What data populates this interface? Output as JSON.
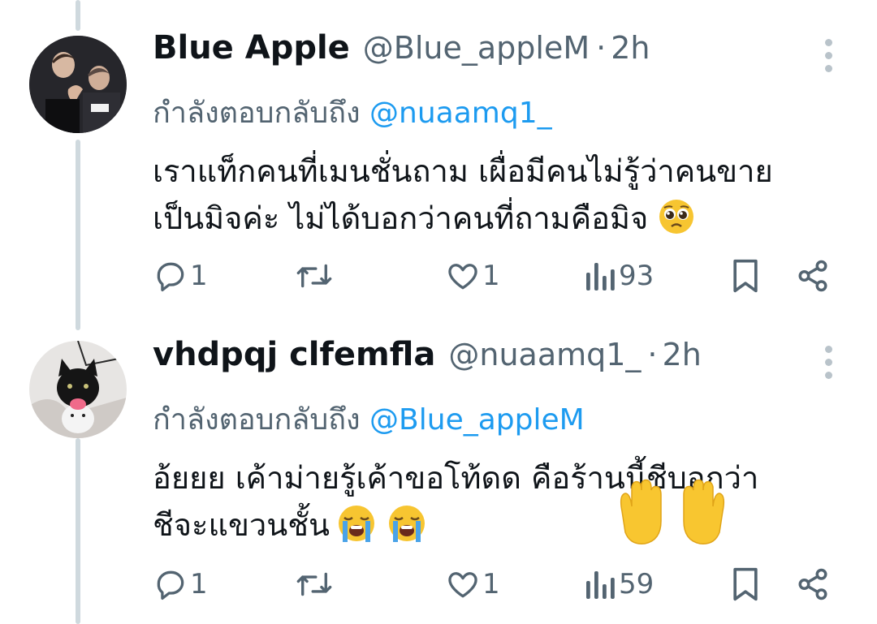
{
  "tweets": [
    {
      "display_name": "Blue Apple",
      "handle": "@Blue_appleM",
      "separator": "·",
      "time": "2h",
      "reply_prefix": "กำลังตอบกลับถึง",
      "reply_mention": "@nuaamq1_",
      "body_lines": [
        "เราแท็กคนที่เมนชั่นถาม เผื่อมีคนไม่รู้ว่าคนขาย",
        "เป็นมิจค่ะ ไม่ได้บอกว่าคนที่ถามคือมิจ"
      ],
      "body_emoji": "pleading-face",
      "stats": {
        "replies": "1",
        "likes": "1",
        "views": "93"
      }
    },
    {
      "display_name": "vhdpqj clfemfla",
      "handle": "@nuaamq1_",
      "separator": "·",
      "time": "2h",
      "reply_prefix": "กำลังตอบกลับถึง",
      "reply_mention": "@Blue_appleM",
      "body_lines": [
        "อ้ยยย เค้าม่ายรู้เค้าขอโท้ดด คือร้านนี้ชีบอกว่า",
        "ชีจะแขวนชั้น"
      ],
      "body_emoji": "loudly-crying-face",
      "stats": {
        "replies": "1",
        "likes": "1",
        "views": "59"
      }
    }
  ],
  "icons": {
    "reply": "reply-icon",
    "retweet": "retweet-icon",
    "like": "heart-icon",
    "views": "views-icon",
    "bookmark": "bookmark-icon",
    "share": "share-icon",
    "more": "more-icon"
  },
  "colors": {
    "text": "#0f1419",
    "secondary": "#536471",
    "mention": "#1d9bf0",
    "thread_line": "#cfd9de"
  }
}
